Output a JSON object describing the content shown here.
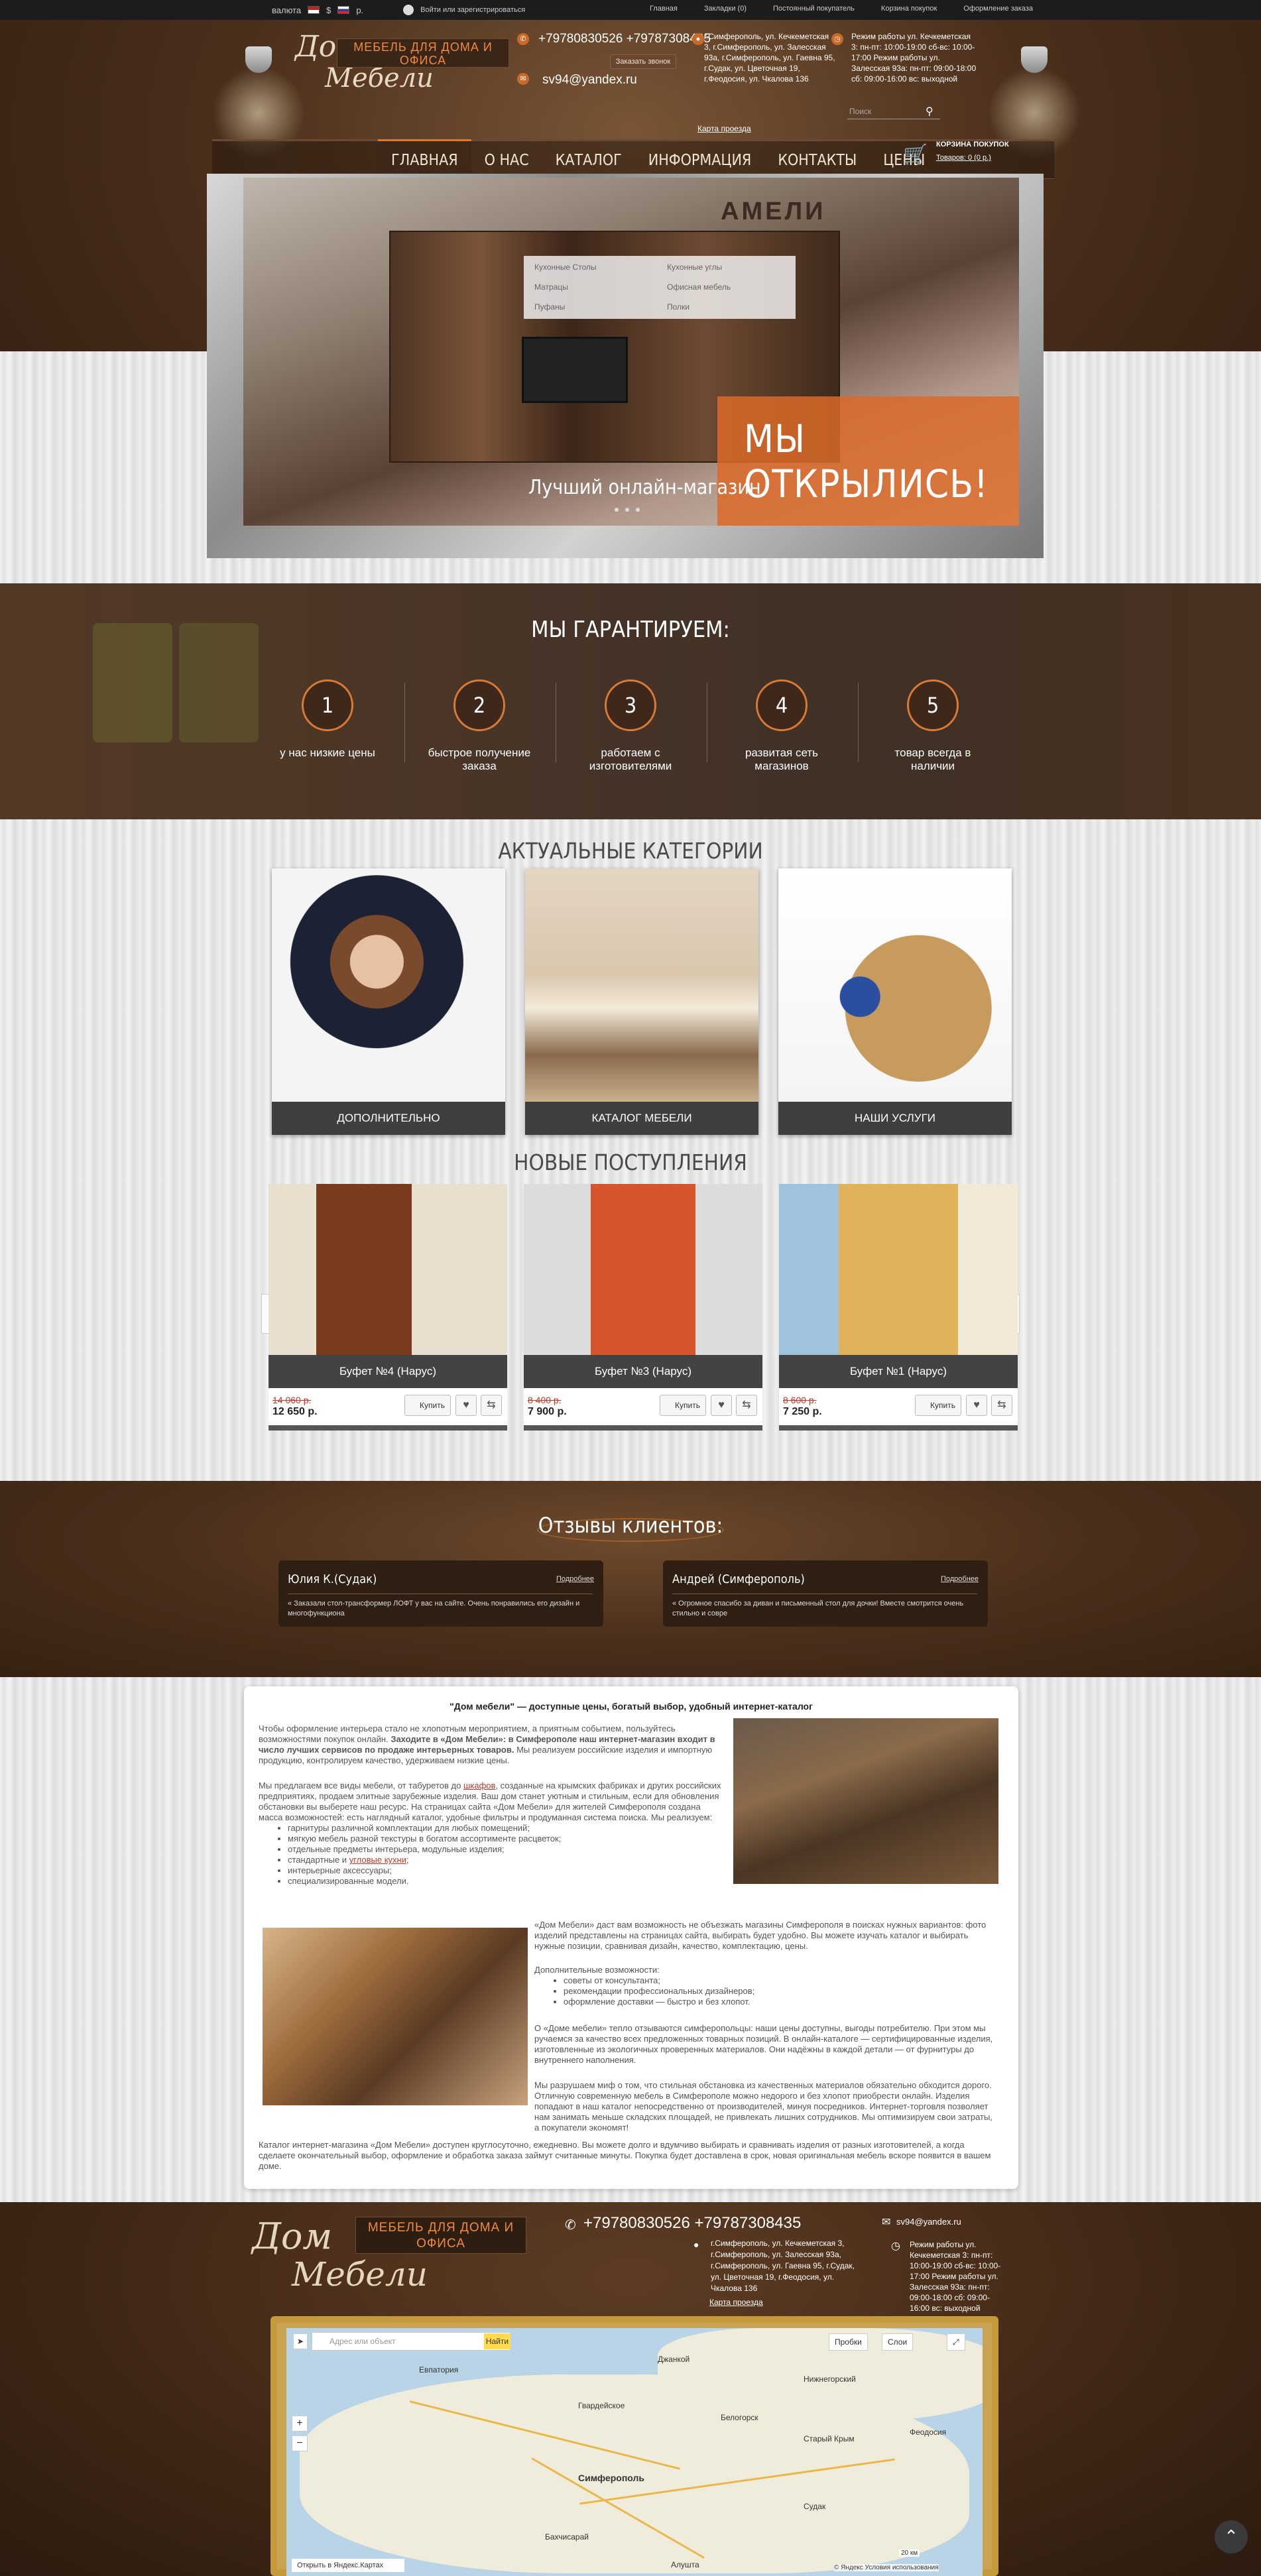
{
  "topbar": {
    "currency_label": "валюта",
    "currency_items": [
      "$",
      "р."
    ],
    "user_text": "Войти или зарегистрироваться",
    "links": [
      "Главная",
      "Закладки (0)",
      "Постоянный покупатель",
      "Корзина покупок",
      "Оформление заказа"
    ]
  },
  "header": {
    "logo_line1": "Дом",
    "logo_line2": "Мебели",
    "slogan": "МЕБЕЛЬ ДЛЯ ДОМА И ОФИСА",
    "phones": "+79780830526 +79787308435",
    "call_button": "Заказать звонок",
    "email": "sv94@yandex.ru",
    "address": "г.Симферополь, ул. Кечкеметская 3, г.Симферополь, ул. Залесская 93а, г.Симферополь, ул. Гаевна 95, г.Судак, ул. Цветочная 19, г.Феодосия, ул. Чкалова 136",
    "map_link": "Карта проезда",
    "hours": "Режим работы ул. Кечкеметская 3: пн-пт: 10:00-19:00 сб-вс: 10:00-17:00 Режим работы ул. Залесская 93а: пн-пт: 09:00-18:00 сб: 09:00-16:00 вс: выходной",
    "search_placeholder": "Поиск",
    "menu": [
      "ГЛАВНАЯ",
      "О НАС",
      "КАТАЛОГ",
      "ИНФОРМАЦИЯ",
      "КОНТАКТЫ",
      "ЦЕНЫ"
    ],
    "cart_title": "КОРЗИНА ПОКУПОК",
    "cart_value": "Товаров: 0 (0 р.)"
  },
  "dropdown": [
    "Кухонные Столы",
    "Кухонные углы",
    "Матрацы",
    "Офисная мебель",
    "Пуфаны",
    "Полки"
  ],
  "slider": {
    "brand": "АМЕЛИ",
    "promo": "МЫ ОТКРЫЛИСЬ!",
    "caption": "Лучший онлайн-магазин"
  },
  "guarantee": {
    "title": "МЫ ГАРАНТИРУЕМ:",
    "items": [
      {
        "num": "1",
        "text": "у нас низкие цены"
      },
      {
        "num": "2",
        "text": "быстрое получение заказа"
      },
      {
        "num": "3",
        "text": "работаем с изготовителями"
      },
      {
        "num": "4",
        "text": "развитая сеть магазинов"
      },
      {
        "num": "5",
        "text": "товар всегда в наличии"
      }
    ]
  },
  "categories": {
    "title": "АКТУАЛЬНЫЕ КАТЕГОРИИ",
    "items": [
      "ДОПОЛНИТЕЛЬНО",
      "КАТАЛОГ МЕБЕЛИ",
      "НАШИ УСЛУГИ"
    ]
  },
  "new_arrivals": {
    "title": "НОВЫЕ ПОСТУПЛЕНИЯ",
    "buy_label": "Купить",
    "items": [
      {
        "name": "Буфет №4 (Нарус)",
        "old_price": "14 060 р.",
        "price": "12 650 р."
      },
      {
        "name": "Буфет №3 (Нарус)",
        "old_price": "8 400 р.",
        "price": "7 900 р."
      },
      {
        "name": "Буфет №1 (Нарус)",
        "old_price": "8 600 р.",
        "price": "7 250 р."
      }
    ]
  },
  "reviews": {
    "title": "Отзывы клиентов:",
    "more_label": "Подробнее",
    "items": [
      {
        "name": "Юлия К.(Судак)",
        "text": "« Заказали стол-трансформер ЛОФТ у вас на сайте. Очень понравились его дизайн и многофункциона"
      },
      {
        "name": "Андрей (Симферополь)",
        "text": "« Огромное спасибо за диван и письменный стол для дочки! Вместе смотрится очень стильно и совре"
      }
    ]
  },
  "text_block": {
    "title": "\"Дом мебели\" — доступные цены, богатый выбор, удобный интернет-каталог",
    "p1_a": "Чтобы оформление интерьера стало не хлопотным мероприятием, а приятным событием, пользуйтесь возможностями покупок онлайн.",
    "p1_b": "Заходите в «Дом Мебели»: в Симферополе наш интернет-магазин входит в число лучших сервисов по продаже интерьерных товаров.",
    "p1_c": "Мы реализуем российские изделия и импортную продукцию, контролируем качество, удерживаем низкие цены.",
    "p2_a": "Мы предлагаем все виды мебели, от табуретов до",
    "p2_link": "шкафов",
    "p2_b": ", созданные на крымских фабриках и других российских предприятиях, продаем элитные зарубежные изделия. Ваш дом станет уютным и стильным, если для обновления обстановки вы выберете наш ресурс. На страницах сайта «Дом Мебели» для жителей Симферополя создана масса возможностей: есть наглядный каталог, удобные фильтры и продуманная система поиска. Мы реализуем:",
    "list1": [
      "гарнитуры различной комплектации для любых помещений;",
      "мягкую мебель разной текстуры в богатом ассортименте расцветок;",
      "отдельные предметы интерьера, модульные изделия;",
      "стандартные и",
      "интерьерные аксессуары;",
      "специализированные модели."
    ],
    "list1_link": "угловые кухни",
    "p3": "«Дом Мебели» даст вам возможность не объезжать магазины Симферополя в поисках нужных вариантов: фото изделий представлены на страницах сайта, выбирать будет удобно. Вы можете изучать каталог и выбирать нужные позиции, сравнивая дизайн, качество, комплектацию, цены.",
    "p4": "Дополнительные возможности:",
    "list2": [
      "советы от консультанта;",
      "рекомендации профессиональных дизайнеров;",
      "оформление доставки — быстро и без хлопот."
    ],
    "p5": "О «Доме мебели» тепло отзываются симферопольцы: наши цены доступны, выгоды потребителю. При этом мы ручаемся за качество всех предложенных товарных позиций. В онлайн-каталоге — сертифицированные изделия, изготовленные из экологичных проверенных материалов. Они надёжны в каждой детали — от фурнитуры до внутреннего наполнения.",
    "p6": "Мы разрушаем миф о том, что стильная обстановка из качественных материалов обязательно обходится дорого. Отличную современную мебель в Симферополе можно недорого и без хлопот приобрести онлайн. Изделия попадают в наш каталог непосредственно от производителей, минуя посредников. Интернет-торговля позволяет нам занимать меньше складских площадей, не привлекать лишних сотрудников. Мы оптимизируем свои затраты, а покупатели экономят!",
    "p7": "Каталог интернет-магазина «Дом Мебели» доступен круглосуточно, ежедневно. Вы можете долго и вдумчиво выбирать и сравнивать изделия от разных изготовителей, а когда сделаете окончательный выбор, оформление и обработка заказа займут считанные минуты. Покупка будет доставлена в срок, новая оригинальная мебель вскоре появится в вашем доме."
  },
  "footer": {
    "logo_line1": "Дом",
    "logo_line2": "Мебели",
    "slogan": "МЕБЕЛЬ ДЛЯ ДОМА И ОФИСА",
    "phones": "+79780830526 +79787308435",
    "email": "sv94@yandex.ru",
    "address": "г.Симферополь, ул. Кечкеметская 3, г.Симферополь, ул. Залесская 93а, г.Симферополь, ул. Гаевна 95, г.Судак, ул. Цветочная 19, г.Феодосия, ул. Чкалова 136",
    "map_link": "Карта проезда",
    "hours": "Режим работы ул. Кечкеметская 3: пн-пт: 10:00-19:00 сб-вс: 10:00-17:00 Режим работы ул. Залесская 93а: пн-пт: 09:00-18:00 сб: 09:00-16:00 вс: выходной"
  },
  "map": {
    "search_placeholder": "Адрес или объект",
    "find_button": "Найти",
    "traffic_button": "Пробки",
    "layers_button": "Слои",
    "open_link": "Открыть в Яндекс.Картах",
    "copyright": "© Яндекс Условия использования",
    "scale": "20 км",
    "cities": [
      "Евпатория",
      "Джанкой",
      "Белогорск",
      "Старый Крым",
      "Феодосия",
      "Симферополь",
      "Бахчисарай",
      "Судак",
      "Алушта",
      "Гвардейское",
      "Нижнегорский"
    ]
  }
}
